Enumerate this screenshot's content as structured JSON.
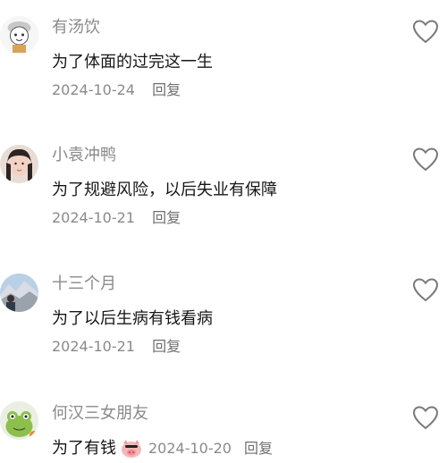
{
  "comments": [
    {
      "username": "有汤饮",
      "text": "为了体面的过完这一生",
      "date": "2024-10-24",
      "reply": "回复",
      "avatar": "cartoon-avatar"
    },
    {
      "username": "小袁冲鸭",
      "text": "为了规避风险，以后失业有保障",
      "date": "2024-10-21",
      "reply": "回复",
      "avatar": "photo-avatar"
    },
    {
      "username": "十三个月",
      "text": "为了以后生病有钱看病",
      "date": "2024-10-21",
      "reply": "回复",
      "avatar": "mountain-avatar"
    },
    {
      "username": "何汉三女朋友",
      "text": "为了有钱",
      "date": "2024-10-20",
      "reply": "回复",
      "avatar": "frog-avatar",
      "emoji": "pig-face-emoji"
    }
  ],
  "colors": {
    "username": "#8a8a8a",
    "text": "#161616",
    "meta": "#8a8a8a",
    "icon": "#7a7a7a"
  }
}
